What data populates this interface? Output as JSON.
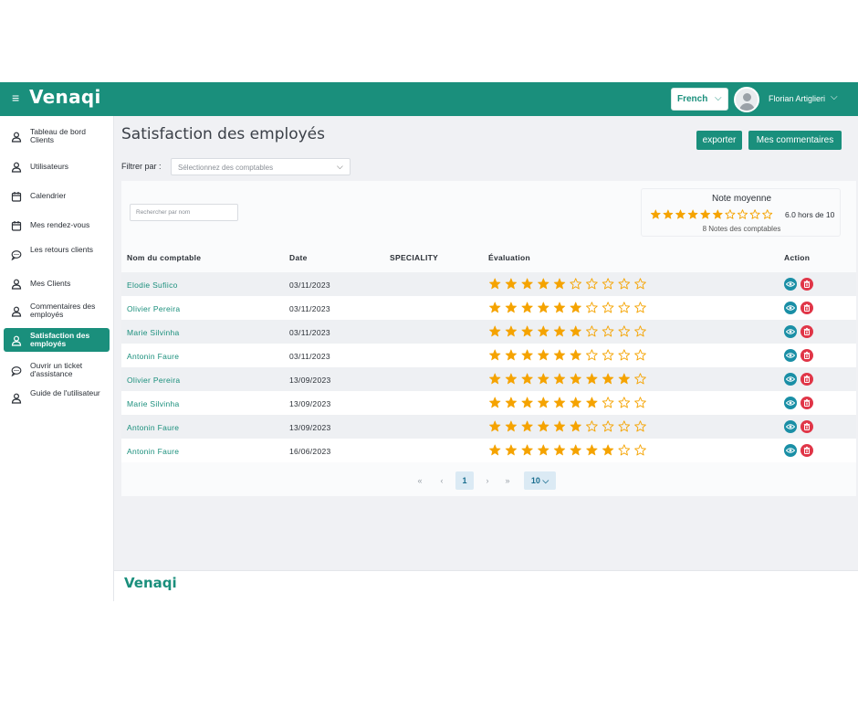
{
  "app": {
    "logo": "Venaqi",
    "menu_icon": "hamburger-icon"
  },
  "header": {
    "language": "French",
    "user_name": "Florian Artiglieri"
  },
  "sidebar": {
    "items": [
      {
        "label": "Tableau de bord Clients",
        "icon": "user-icon",
        "active": false
      },
      {
        "label": "Utilisateurs",
        "icon": "user-icon",
        "active": false
      },
      {
        "label": "Calendrier",
        "icon": "calendar-icon",
        "active": false
      },
      {
        "label": "Mes rendez-vous",
        "icon": "calendar-icon",
        "active": false
      },
      {
        "label": "Les retours clients",
        "icon": "chat-icon",
        "active": false
      },
      {
        "label": "Mes Clients",
        "icon": "user-icon",
        "active": false
      },
      {
        "label": "Commentaires des employés",
        "icon": "user-icon",
        "active": false
      },
      {
        "label": "Satisfaction des employés",
        "icon": "user-icon",
        "active": true
      },
      {
        "label": "Ouvrir un ticket d'assistance",
        "icon": "chat-icon",
        "active": false
      },
      {
        "label": "Guide de l'utilisateur",
        "icon": "user-icon",
        "active": false
      }
    ]
  },
  "page": {
    "title": "Satisfaction des employés",
    "export_label": "exporter",
    "comments_label": "Mes commentaires",
    "filter_label": "Filtrer par :",
    "filter_placeholder": "Sélectionnez des comptables",
    "search_placeholder": "Rechercher par nom"
  },
  "summary": {
    "title": "Note moyenne",
    "average": 6.0,
    "max": 10,
    "text": "6.0 hors de 10",
    "count_text": "8 Notes des comptables"
  },
  "table": {
    "columns": [
      "Nom du comptable",
      "Date",
      "SPECIALITY",
      "Évaluation",
      "Action"
    ],
    "rows": [
      {
        "name": "Elodie Sufiico",
        "date": "03/11/2023",
        "speciality": "",
        "rating": 5
      },
      {
        "name": "Olivier Pereira",
        "date": "03/11/2023",
        "speciality": "",
        "rating": 6
      },
      {
        "name": "Marie Silvinha",
        "date": "03/11/2023",
        "speciality": "",
        "rating": 6
      },
      {
        "name": "Antonin Faure",
        "date": "03/11/2023",
        "speciality": "",
        "rating": 6
      },
      {
        "name": "Olivier Pereira",
        "date": "13/09/2023",
        "speciality": "",
        "rating": 9
      },
      {
        "name": "Marie Silvinha",
        "date": "13/09/2023",
        "speciality": "",
        "rating": 7
      },
      {
        "name": "Antonin Faure",
        "date": "13/09/2023",
        "speciality": "",
        "rating": 6
      },
      {
        "name": "Antonin Faure",
        "date": "16/06/2023",
        "speciality": "",
        "rating": 8
      }
    ],
    "star_total": 10
  },
  "pagination": {
    "first": "«",
    "prev": "‹",
    "current": "1",
    "next": "›",
    "last": "»",
    "page_size": "10"
  },
  "footer": {
    "logo": "Venaqi"
  },
  "colors": {
    "accent": "#1a8f7c",
    "star": "#f5a300",
    "view": "#1a8fa6",
    "delete": "#e03547"
  }
}
